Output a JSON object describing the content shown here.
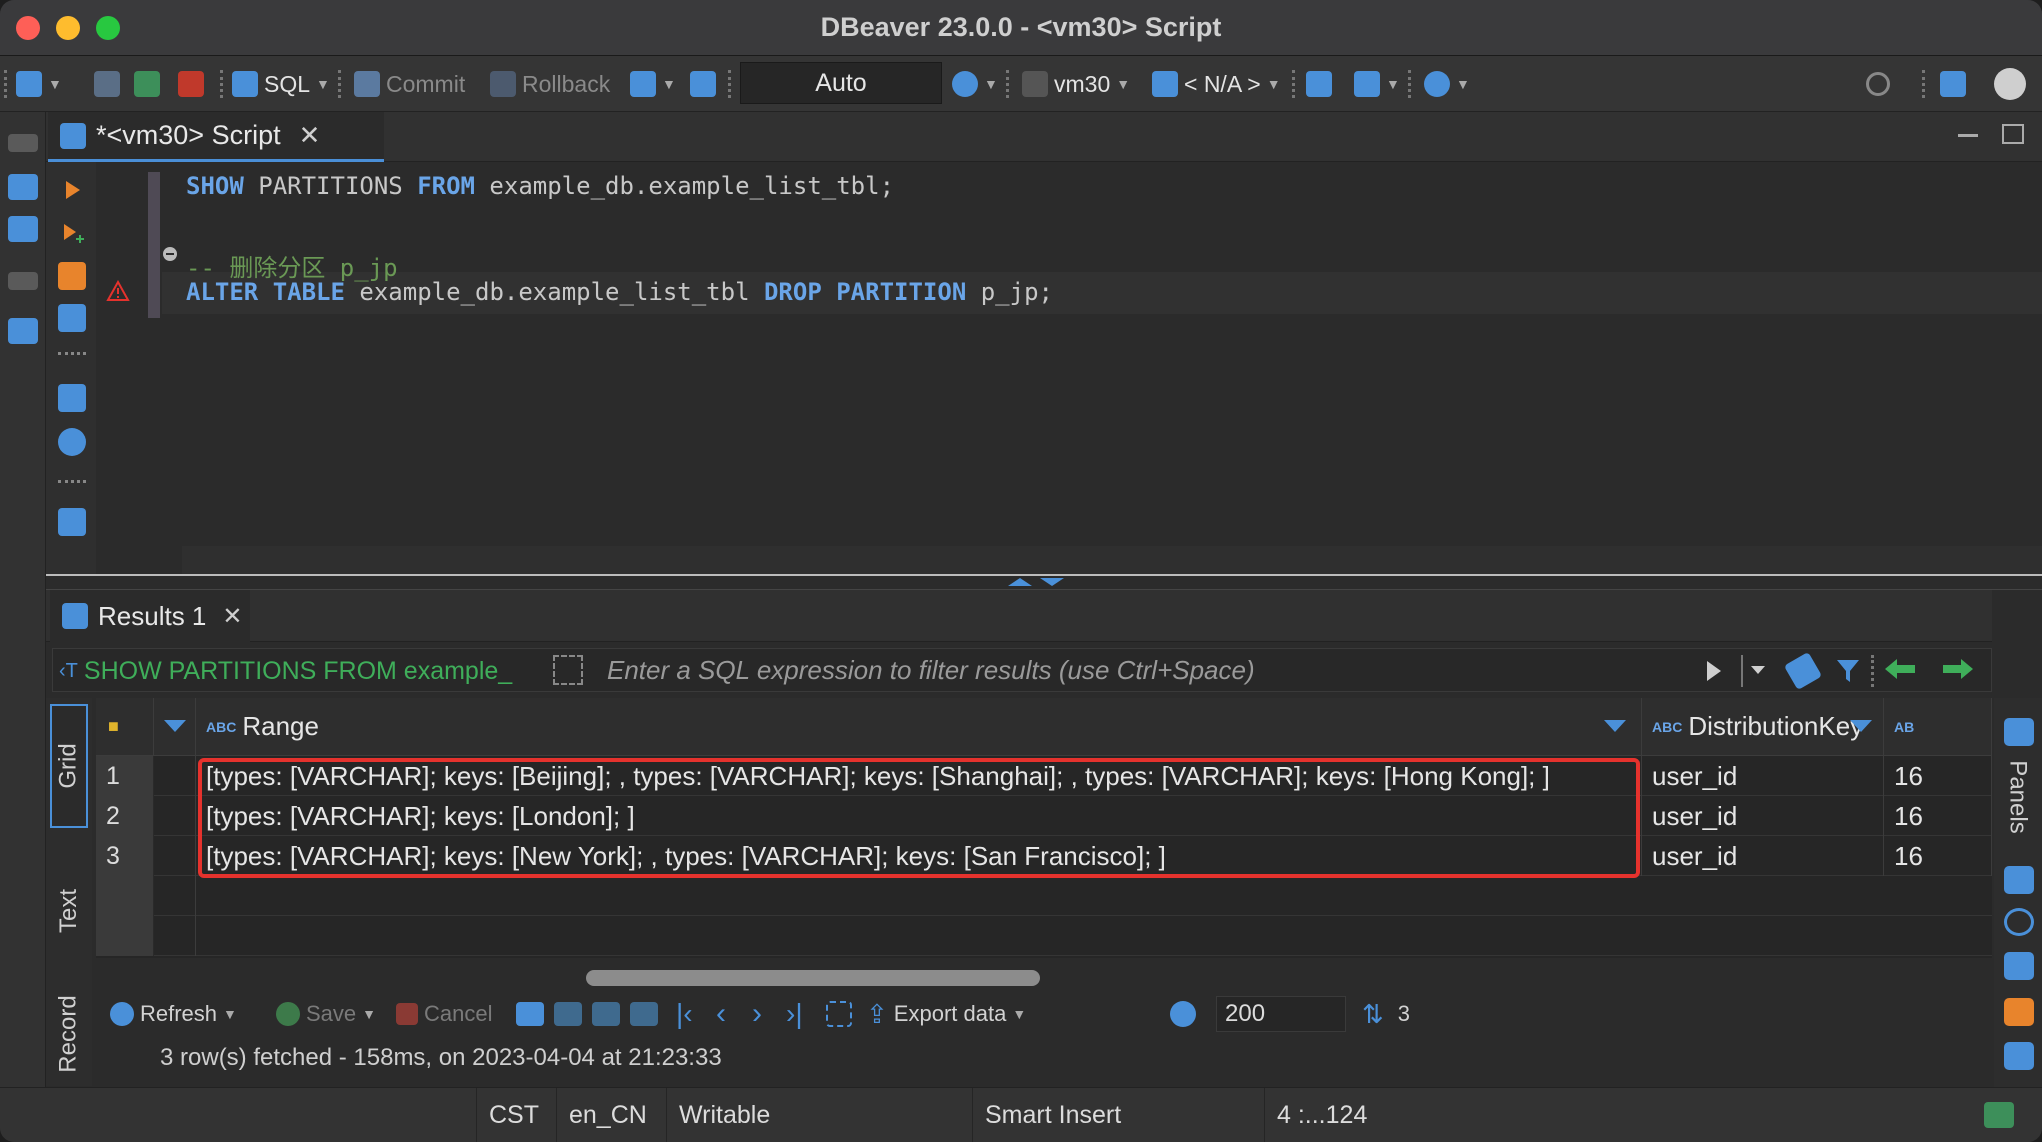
{
  "window": {
    "title": "DBeaver 23.0.0 - <vm30> Script"
  },
  "toolbar": {
    "sql_label": "SQL",
    "commit_label": "Commit",
    "rollback_label": "Rollback",
    "transaction_mode": "Auto",
    "connection": "vm30",
    "schema": "< N/A >"
  },
  "editor": {
    "tab_title": "*<vm30> Script",
    "lines": [
      {
        "parts": [
          {
            "t": "SHOW",
            "k": "kw"
          },
          {
            "t": " PARTITIONS ",
            "k": ""
          },
          {
            "t": "FROM",
            "k": "kw"
          },
          {
            "t": " example_db.example_list_tbl;",
            "k": ""
          }
        ]
      },
      {
        "parts": [
          {
            "t": "-- 删除分区 p_jp",
            "k": "cm"
          }
        ]
      },
      {
        "parts": [
          {
            "t": "ALTER",
            "k": "kw"
          },
          {
            "t": " ",
            "k": ""
          },
          {
            "t": "TABLE",
            "k": "kw"
          },
          {
            "t": " example_db.example_list_tbl ",
            "k": ""
          },
          {
            "t": "DROP",
            "k": "kw"
          },
          {
            "t": " ",
            "k": ""
          },
          {
            "t": "PARTITION",
            "k": "kw"
          },
          {
            "t": " p_jp;",
            "k": ""
          }
        ]
      }
    ]
  },
  "results": {
    "tab_label": "Results 1",
    "query_preview": "SHOW PARTITIONS FROM example_",
    "filter_placeholder": "Enter a SQL expression to filter results (use Ctrl+Space)",
    "side_tabs": {
      "grid": "Grid",
      "text": "Text",
      "record": "Record"
    },
    "right_panel_label": "Panels",
    "columns": [
      "Range",
      "DistributionKey"
    ],
    "rows": [
      {
        "num": "1",
        "range": "[types: [VARCHAR]; keys: [Beijing]; , types: [VARCHAR]; keys: [Shanghai]; , types: [VARCHAR]; keys: [Hong Kong]; ]",
        "key": "user_id",
        "extra": "16"
      },
      {
        "num": "2",
        "range": "[types: [VARCHAR]; keys: [London]; ]",
        "key": "user_id",
        "extra": "16"
      },
      {
        "num": "3",
        "range": "[types: [VARCHAR]; keys: [New York]; , types: [VARCHAR]; keys: [San Francisco]; ]",
        "key": "user_id",
        "extra": "16"
      }
    ],
    "toolbar": {
      "refresh": "Refresh",
      "save": "Save",
      "cancel": "Cancel",
      "export": "Export data",
      "fetch_size": "200",
      "row_count": "3"
    },
    "status": "3 row(s) fetched - 158ms, on 2023-04-04 at 21:23:33"
  },
  "statusbar": {
    "timezone": "CST",
    "locale": "en_CN",
    "mode": "Writable",
    "insert_mode": "Smart Insert",
    "cursor": "4 :...124"
  },
  "colors": {
    "accent": "#4a90d9",
    "keyword": "#6aa5e8",
    "comment": "#6a9955",
    "highlight_border": "#e5322d"
  }
}
